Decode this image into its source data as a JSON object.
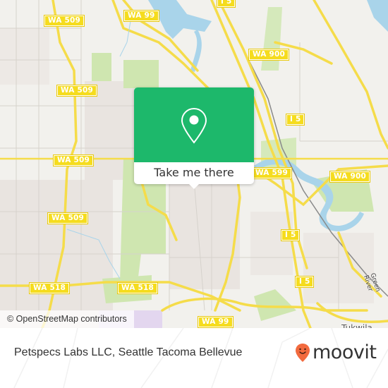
{
  "map": {
    "road_shields": [
      {
        "label": "WA 509"
      },
      {
        "label": "WA 99"
      },
      {
        "label": "I 5"
      },
      {
        "label": "WA 900"
      },
      {
        "label": "WA 509"
      },
      {
        "label": "I 5"
      },
      {
        "label": "WA 509"
      },
      {
        "label": "WA 599"
      },
      {
        "label": "WA 900"
      },
      {
        "label": "WA 509"
      },
      {
        "label": "I 5"
      },
      {
        "label": "WA 518"
      },
      {
        "label": "WA 518"
      },
      {
        "label": "I 5"
      },
      {
        "label": "WA 99"
      }
    ],
    "place_labels": {
      "tukwila": "Tukwila",
      "green_river": "Green River"
    },
    "attribution": "© OpenStreetMap contributors",
    "colors": {
      "background": "#f2f1ed",
      "road": "#f5dc4a",
      "water": "#a9d4ea",
      "park": "#cfe6b0",
      "popup_green": "#1db86b"
    }
  },
  "popup": {
    "icon": "location-pin-icon",
    "button_label": "Take me there"
  },
  "footer": {
    "place_title": "Petspecs Labs LLC, Seattle Tacoma Bellevue",
    "brand": "moovit",
    "brand_color": "#f26a3e"
  }
}
